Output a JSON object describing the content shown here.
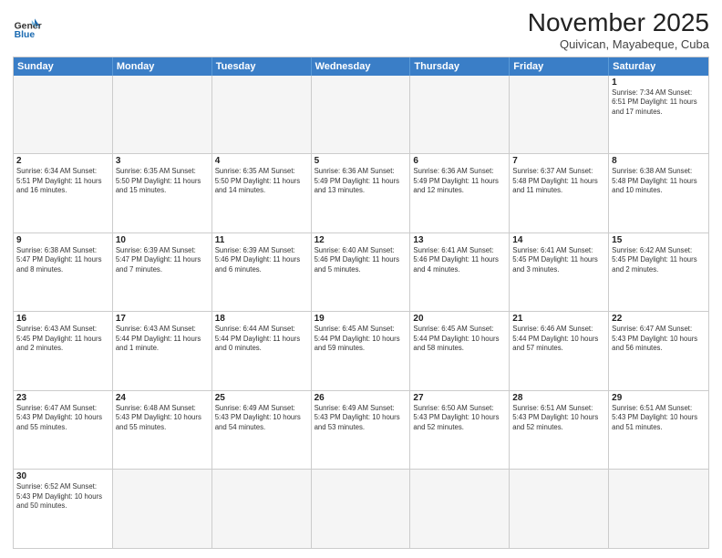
{
  "header": {
    "logo_general": "General",
    "logo_blue": "Blue",
    "title": "November 2025",
    "subtitle": "Quivican, Mayabeque, Cuba"
  },
  "weekdays": [
    "Sunday",
    "Monday",
    "Tuesday",
    "Wednesday",
    "Thursday",
    "Friday",
    "Saturday"
  ],
  "weeks": [
    [
      {
        "day": "",
        "info": ""
      },
      {
        "day": "",
        "info": ""
      },
      {
        "day": "",
        "info": ""
      },
      {
        "day": "",
        "info": ""
      },
      {
        "day": "",
        "info": ""
      },
      {
        "day": "",
        "info": ""
      },
      {
        "day": "1",
        "info": "Sunrise: 7:34 AM\nSunset: 6:51 PM\nDaylight: 11 hours and 17 minutes."
      }
    ],
    [
      {
        "day": "2",
        "info": "Sunrise: 6:34 AM\nSunset: 5:51 PM\nDaylight: 11 hours and 16 minutes."
      },
      {
        "day": "3",
        "info": "Sunrise: 6:35 AM\nSunset: 5:50 PM\nDaylight: 11 hours and 15 minutes."
      },
      {
        "day": "4",
        "info": "Sunrise: 6:35 AM\nSunset: 5:50 PM\nDaylight: 11 hours and 14 minutes."
      },
      {
        "day": "5",
        "info": "Sunrise: 6:36 AM\nSunset: 5:49 PM\nDaylight: 11 hours and 13 minutes."
      },
      {
        "day": "6",
        "info": "Sunrise: 6:36 AM\nSunset: 5:49 PM\nDaylight: 11 hours and 12 minutes."
      },
      {
        "day": "7",
        "info": "Sunrise: 6:37 AM\nSunset: 5:48 PM\nDaylight: 11 hours and 11 minutes."
      },
      {
        "day": "8",
        "info": "Sunrise: 6:38 AM\nSunset: 5:48 PM\nDaylight: 11 hours and 10 minutes."
      }
    ],
    [
      {
        "day": "9",
        "info": "Sunrise: 6:38 AM\nSunset: 5:47 PM\nDaylight: 11 hours and 8 minutes."
      },
      {
        "day": "10",
        "info": "Sunrise: 6:39 AM\nSunset: 5:47 PM\nDaylight: 11 hours and 7 minutes."
      },
      {
        "day": "11",
        "info": "Sunrise: 6:39 AM\nSunset: 5:46 PM\nDaylight: 11 hours and 6 minutes."
      },
      {
        "day": "12",
        "info": "Sunrise: 6:40 AM\nSunset: 5:46 PM\nDaylight: 11 hours and 5 minutes."
      },
      {
        "day": "13",
        "info": "Sunrise: 6:41 AM\nSunset: 5:46 PM\nDaylight: 11 hours and 4 minutes."
      },
      {
        "day": "14",
        "info": "Sunrise: 6:41 AM\nSunset: 5:45 PM\nDaylight: 11 hours and 3 minutes."
      },
      {
        "day": "15",
        "info": "Sunrise: 6:42 AM\nSunset: 5:45 PM\nDaylight: 11 hours and 2 minutes."
      }
    ],
    [
      {
        "day": "16",
        "info": "Sunrise: 6:43 AM\nSunset: 5:45 PM\nDaylight: 11 hours and 2 minutes."
      },
      {
        "day": "17",
        "info": "Sunrise: 6:43 AM\nSunset: 5:44 PM\nDaylight: 11 hours and 1 minute."
      },
      {
        "day": "18",
        "info": "Sunrise: 6:44 AM\nSunset: 5:44 PM\nDaylight: 11 hours and 0 minutes."
      },
      {
        "day": "19",
        "info": "Sunrise: 6:45 AM\nSunset: 5:44 PM\nDaylight: 10 hours and 59 minutes."
      },
      {
        "day": "20",
        "info": "Sunrise: 6:45 AM\nSunset: 5:44 PM\nDaylight: 10 hours and 58 minutes."
      },
      {
        "day": "21",
        "info": "Sunrise: 6:46 AM\nSunset: 5:44 PM\nDaylight: 10 hours and 57 minutes."
      },
      {
        "day": "22",
        "info": "Sunrise: 6:47 AM\nSunset: 5:43 PM\nDaylight: 10 hours and 56 minutes."
      }
    ],
    [
      {
        "day": "23",
        "info": "Sunrise: 6:47 AM\nSunset: 5:43 PM\nDaylight: 10 hours and 55 minutes."
      },
      {
        "day": "24",
        "info": "Sunrise: 6:48 AM\nSunset: 5:43 PM\nDaylight: 10 hours and 55 minutes."
      },
      {
        "day": "25",
        "info": "Sunrise: 6:49 AM\nSunset: 5:43 PM\nDaylight: 10 hours and 54 minutes."
      },
      {
        "day": "26",
        "info": "Sunrise: 6:49 AM\nSunset: 5:43 PM\nDaylight: 10 hours and 53 minutes."
      },
      {
        "day": "27",
        "info": "Sunrise: 6:50 AM\nSunset: 5:43 PM\nDaylight: 10 hours and 52 minutes."
      },
      {
        "day": "28",
        "info": "Sunrise: 6:51 AM\nSunset: 5:43 PM\nDaylight: 10 hours and 52 minutes."
      },
      {
        "day": "29",
        "info": "Sunrise: 6:51 AM\nSunset: 5:43 PM\nDaylight: 10 hours and 51 minutes."
      }
    ],
    [
      {
        "day": "30",
        "info": "Sunrise: 6:52 AM\nSunset: 5:43 PM\nDaylight: 10 hours and 50 minutes."
      },
      {
        "day": "",
        "info": ""
      },
      {
        "day": "",
        "info": ""
      },
      {
        "day": "",
        "info": ""
      },
      {
        "day": "",
        "info": ""
      },
      {
        "day": "",
        "info": ""
      },
      {
        "day": "",
        "info": ""
      }
    ]
  ]
}
